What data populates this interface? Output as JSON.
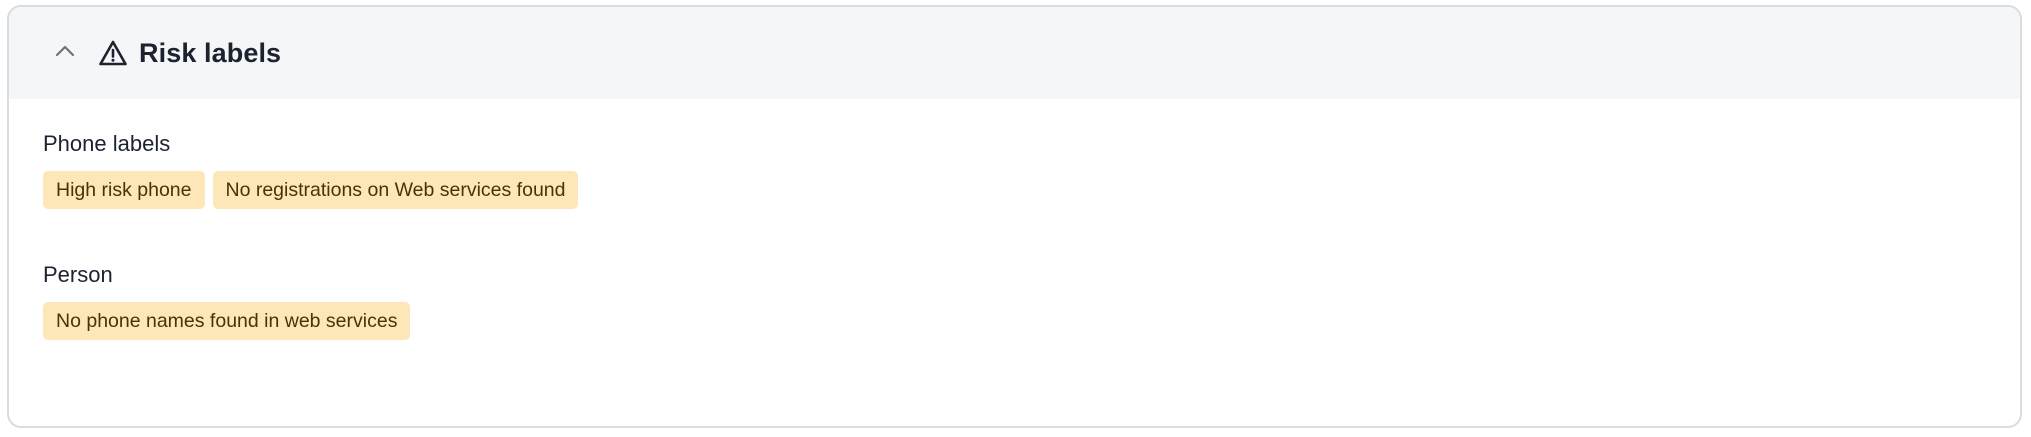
{
  "panel": {
    "title": "Risk labels",
    "collapse_icon": "chevron-up-icon",
    "title_icon": "warning-triangle-icon"
  },
  "sections": [
    {
      "label": "Phone labels",
      "tags": [
        "High risk phone",
        "No registrations on Web services found"
      ]
    },
    {
      "label": "Person",
      "tags": [
        "No phone names found in web services"
      ]
    }
  ],
  "colors": {
    "header_bg": "#f5f6f8",
    "tag_bg": "#fde7b8",
    "tag_text": "#4a3206",
    "text": "#1c2230",
    "border": "#d9dce1"
  }
}
